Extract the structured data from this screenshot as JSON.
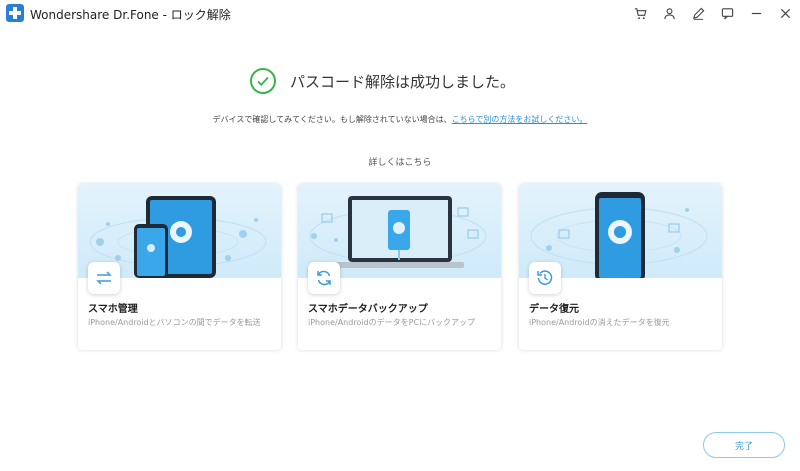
{
  "window": {
    "title": "Wondershare Dr.Fone - ロック解除",
    "toolbar_icons": [
      "cart-icon",
      "user-icon",
      "edit-icon",
      "feedback-icon",
      "minimize-icon",
      "close-icon"
    ]
  },
  "result": {
    "title": "パスコード解除は成功しました。",
    "hint_text": "デバイスで確認してみてください。もし解除されていない場合は、",
    "hint_link": "こちらで別の方法をお試しください。",
    "status_color": "#38b24a",
    "link_color": "#2b8fd9"
  },
  "more_label": "詳しくはこちら",
  "cards": [
    {
      "title": "スマホ管理",
      "description": "iPhone/Androidとパソコンの間でデータを転送",
      "icon": "transfer-icon"
    },
    {
      "title": "スマホデータバックアップ",
      "description": "iPhone/AndroidのデータをPCにバックアップ",
      "icon": "backup-icon"
    },
    {
      "title": "データ復元",
      "description": "iPhone/Androidの消えたデータを復元",
      "icon": "restore-icon"
    }
  ],
  "done_button": "完了"
}
